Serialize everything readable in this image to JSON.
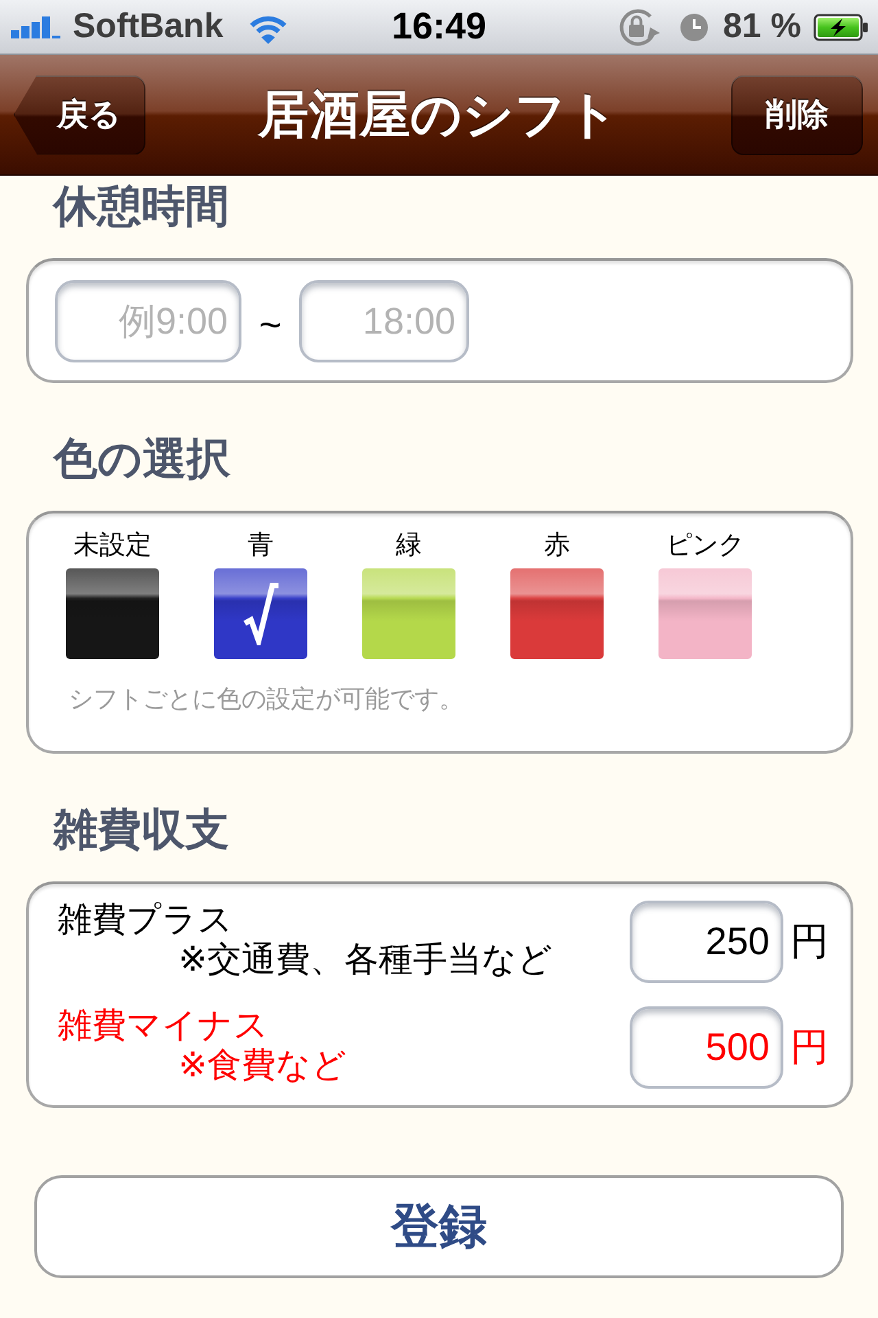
{
  "status_bar": {
    "carrier": "SoftBank",
    "time": "16:49",
    "battery": "81 %"
  },
  "nav_bar": {
    "back_button": "戻る",
    "title": "居酒屋のシフト",
    "right_button": "削除"
  },
  "break_time": {
    "heading": "休憩時間",
    "start": {
      "placeholder": "例9:00"
    },
    "separator": "~",
    "end": {
      "placeholder": "18:00"
    }
  },
  "color_selection": {
    "heading": "色の選択",
    "colors": [
      {
        "label": "未設定",
        "color": "#161616",
        "selected": false
      },
      {
        "label": "青",
        "color": "#2f37c6",
        "selected": true
      },
      {
        "label": "緑",
        "color": "#b4d84a",
        "selected": false
      },
      {
        "label": "赤",
        "color": "#da3a3a",
        "selected": false
      },
      {
        "label": "ピンク",
        "color": "#f3b4c6",
        "selected": false
      }
    ],
    "note": "シフトごとに色の設定が可能です。"
  },
  "misc_expenses": {
    "heading": "雑費収支",
    "rows": [
      {
        "kind": "plus",
        "label": "雑費プラス",
        "note": "※交通費、各種手当など",
        "value": "250",
        "unit": "円"
      },
      {
        "kind": "minus",
        "label": "雑費マイナス",
        "note": "※食費など",
        "value": "500",
        "unit": "円"
      }
    ]
  },
  "register_button": "登録"
}
